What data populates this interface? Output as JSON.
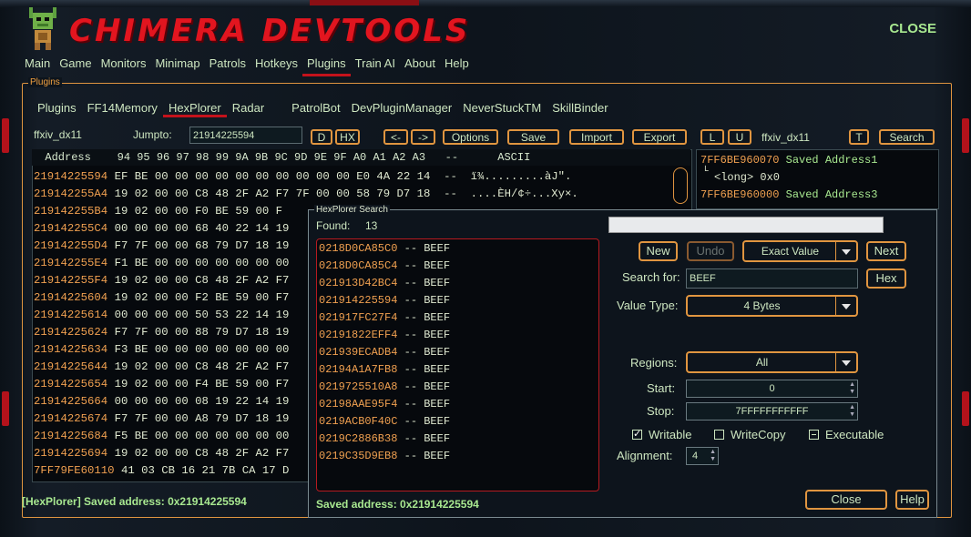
{
  "app": {
    "title": "CHIMERA DEVTOOLS",
    "close_label": "CLOSE"
  },
  "menu": [
    "Main",
    "Game",
    "Monitors",
    "Minimap",
    "Patrols",
    "Hotkeys",
    "Plugins",
    "Train AI",
    "About",
    "Help"
  ],
  "plugins_panel": {
    "legend": "Plugins",
    "tabs": [
      "Plugins",
      "FF14Memory",
      "HexPlorer",
      "Radar",
      "PatrolBot",
      "DevPluginManager",
      "NeverStuckTM",
      "SkillBinder"
    ]
  },
  "hexplorer": {
    "process": "ffxiv_dx11",
    "jumpto_label": "Jumpto:",
    "jumpto_value": "21914225594",
    "buttons": {
      "d": "D",
      "hx": "HX",
      "back": "<-",
      "fwd": "->",
      "options": "Options",
      "save": "Save",
      "import": "Import",
      "export": "Export",
      "l": "L",
      "u": "U",
      "t": "T",
      "search": "Search"
    },
    "process2": "ffxiv_dx11",
    "header": "  Address    94 95 96 97 98 99 9A 9B 9C 9D 9E 9F A0 A1 A2 A3   --      ASCII",
    "rows": [
      {
        "addr": "21914225594",
        "bytes": " EF BE 00 00 00 00 00 00 00 00 00 00 E0 4A 22 14  --  ï¾.........àJ\"."
      },
      {
        "addr": "219142255A4",
        "bytes": " 19 02 00 00 C8 48 2F A2 F7 7F 00 00 58 79 D7 18  --  ....ÈH/¢÷...Xy×."
      },
      {
        "addr": "219142255B4",
        "bytes": " 19 02 00 00 F0 BE 59 00 F"
      },
      {
        "addr": "219142255C4",
        "bytes": " 00 00 00 00 68 40 22 14 19"
      },
      {
        "addr": "219142255D4",
        "bytes": " F7 7F 00 00 68 79 D7 18 19"
      },
      {
        "addr": "219142255E4",
        "bytes": " F1 BE 00 00 00 00 00 00 00"
      },
      {
        "addr": "219142255F4",
        "bytes": " 19 02 00 00 C8 48 2F A2 F7"
      },
      {
        "addr": "21914225604",
        "bytes": " 19 02 00 00 F2 BE 59 00 F7"
      },
      {
        "addr": "21914225614",
        "bytes": " 00 00 00 00 50 53 22 14 19"
      },
      {
        "addr": "21914225624",
        "bytes": " F7 7F 00 00 88 79 D7 18 19"
      },
      {
        "addr": "21914225634",
        "bytes": " F3 BE 00 00 00 00 00 00 00"
      },
      {
        "addr": "21914225644",
        "bytes": " 19 02 00 00 C8 48 2F A2 F7"
      },
      {
        "addr": "21914225654",
        "bytes": " 19 02 00 00 F4 BE 59 00 F7"
      },
      {
        "addr": "21914225664",
        "bytes": " 00 00 00 00 08 19 22 14 19"
      },
      {
        "addr": "21914225674",
        "bytes": " F7 7F 00 00 A8 79 D7 18 19"
      },
      {
        "addr": "21914225684",
        "bytes": " F5 BE 00 00 00 00 00 00 00"
      },
      {
        "addr": "21914225694",
        "bytes": " 19 02 00 00 C8 48 2F A2 F7"
      },
      {
        "addr": "7FF79FE60110",
        "bytes": " 41 03 CB 16 21 7B CA 17 D"
      }
    ],
    "saved": [
      {
        "addr": "7FF6BE960070",
        "label": " Saved Address1"
      },
      {
        "sub": "<long> 0x0"
      },
      {
        "addr": "7FF6BE960000",
        "label": " Saved Address3"
      }
    ],
    "status": "[HexPlorer] Saved address: 0x21914225594"
  },
  "search_dialog": {
    "legend": "HexPlorer Search",
    "found_label": "Found:",
    "found_count": "13",
    "results": [
      {
        "addr": "0218D0CA85C0",
        "val": " -- BEEF"
      },
      {
        "addr": "0218D0CA85C4",
        "val": " -- BEEF"
      },
      {
        "addr": "021913D42BC4",
        "val": " -- BEEF"
      },
      {
        "addr": "021914225594",
        "val": " -- BEEF"
      },
      {
        "addr": "021917FC27F4",
        "val": " -- BEEF"
      },
      {
        "addr": "02191822EFF4",
        "val": " -- BEEF"
      },
      {
        "addr": "021939ECADB4",
        "val": " -- BEEF"
      },
      {
        "addr": "02194A1A7FB8",
        "val": " -- BEEF"
      },
      {
        "addr": "0219725510A8",
        "val": " -- BEEF"
      },
      {
        "addr": "02198AAE95F4",
        "val": " -- BEEF"
      },
      {
        "addr": "0219ACB0F40C",
        "val": " -- BEEF"
      },
      {
        "addr": "0219C2886B38",
        "val": " -- BEEF"
      },
      {
        "addr": "0219C35D9EB8",
        "val": " -- BEEF"
      }
    ],
    "new_label": "New",
    "undo_label": "Undo",
    "scan_type": "Exact Value",
    "next_label": "Next",
    "search_for_label": "Search for:",
    "search_for_value": "BEEF",
    "hex_label": "Hex",
    "value_type_label": "Value Type:",
    "value_type": "4 Bytes",
    "regions_label": "Regions:",
    "regions": "All",
    "start_label": "Start:",
    "start_value": "0",
    "stop_label": "Stop:",
    "stop_value": "7FFFFFFFFFFF",
    "writable_label": "Writable",
    "writecopy_label": "WriteCopy",
    "executable_label": "Executable",
    "alignment_label": "Alignment:",
    "alignment_value": "4",
    "close_label": "Close",
    "help_label": "Help",
    "status": "Saved address: 0x21914225594"
  }
}
